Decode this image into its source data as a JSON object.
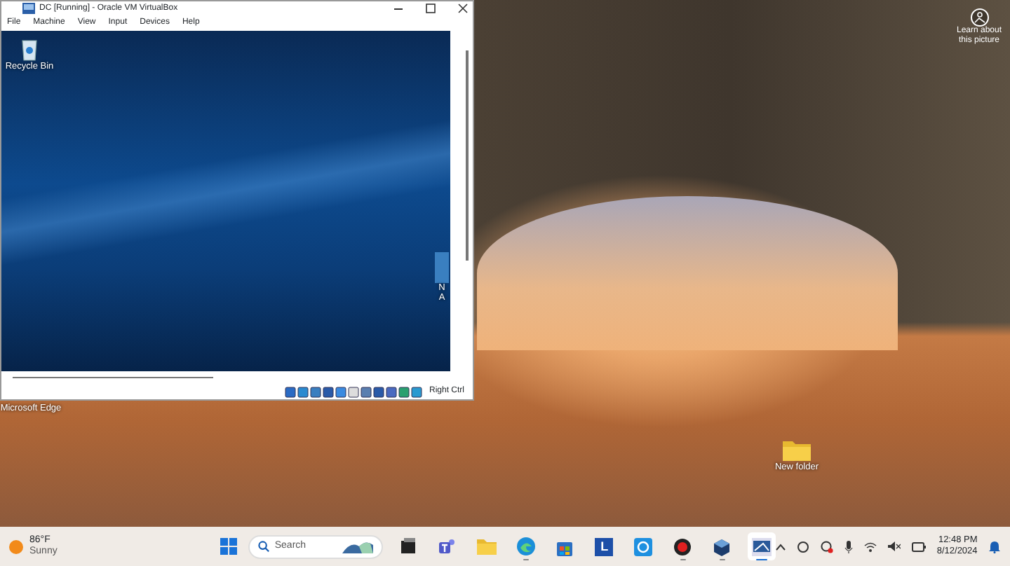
{
  "desktop": {
    "learn_more": "Learn about this picture",
    "icons": [
      {
        "kind": "edge",
        "label": "Microsoft Edge"
      },
      {
        "kind": "folder",
        "label": "New folder"
      }
    ]
  },
  "vm_window": {
    "title": "DC [Running] - Oracle VM VirtualBox",
    "menu": [
      "File",
      "Machine",
      "View",
      "Input",
      "Devices",
      "Help"
    ],
    "guest": {
      "icons": [
        {
          "kind": "recycle",
          "label": "Recycle Bin"
        }
      ],
      "partial_icon_lines": [
        "N",
        "A"
      ]
    },
    "status_bar": {
      "host_key": "Right Ctrl"
    }
  },
  "taskbar": {
    "weather": {
      "temp": "86°F",
      "condition": "Sunny"
    },
    "search": {
      "placeholder": "Search"
    },
    "apps": [
      {
        "kind": "taskview",
        "running": false,
        "active": false
      },
      {
        "kind": "teams",
        "running": false,
        "active": false
      },
      {
        "kind": "explorer",
        "running": false,
        "active": false
      },
      {
        "kind": "edge",
        "running": true,
        "active": false
      },
      {
        "kind": "store",
        "running": false,
        "active": false
      },
      {
        "kind": "letter",
        "running": false,
        "active": false
      },
      {
        "kind": "ring",
        "running": false,
        "active": false
      },
      {
        "kind": "record",
        "running": true,
        "active": false
      },
      {
        "kind": "vbox",
        "running": true,
        "active": false
      },
      {
        "kind": "vm",
        "running": true,
        "active": true
      }
    ],
    "letter_app": "L",
    "time": "12:48 PM",
    "date": "8/12/2024"
  }
}
